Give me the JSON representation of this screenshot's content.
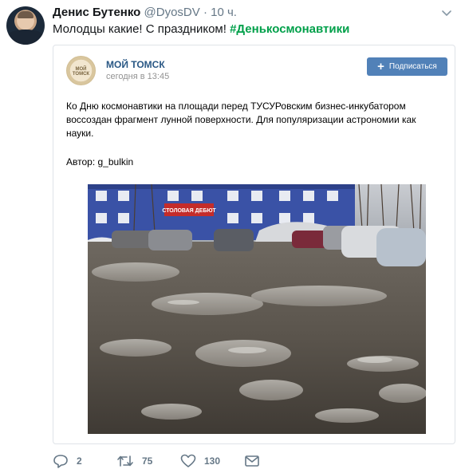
{
  "tweet": {
    "author_name": "Денис Бутенко",
    "handle": "@DyosDV",
    "separator": "·",
    "time": "10 ч.",
    "text": "Молодцы какие! С праздником! ",
    "hashtag": "#Денькосмонавтики"
  },
  "card": {
    "logo_text": "МОЙ ТОМСК",
    "group_name": "МОЙ ТОМСК",
    "posted": "сегодня в 13:45",
    "subscribe_label": "Подписаться",
    "body": "Ко Дню космонавтики на площади перед ТУСУРовским бизнес-инкубатором воссоздан фрагмент лунной поверхности. Для популяризации астрономии как науки.",
    "author_line": "Автор: g_bulkin",
    "photo_sign": "СТОЛОВАЯ ДЕБЮТ"
  },
  "actions": {
    "replies": "2",
    "retweets": "75",
    "likes": "130"
  },
  "colors": {
    "hashtag": "#00a04a",
    "vk_blue": "#5181b8",
    "vk_link": "#2a5885"
  }
}
